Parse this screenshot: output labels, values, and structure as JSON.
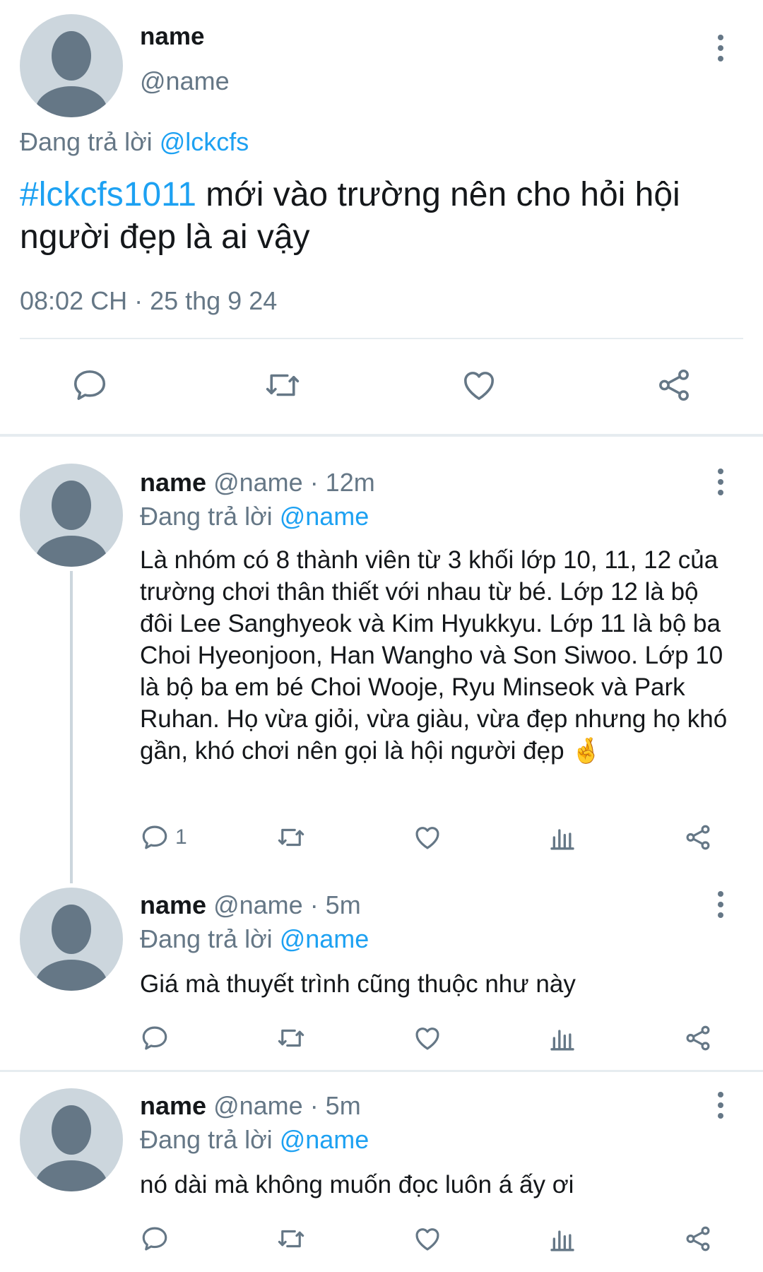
{
  "main_tweet": {
    "display_name": "name",
    "handle": "@name",
    "replying_to_label": "Đang trả lời",
    "replying_to_handle": "@lckcfs",
    "hashtag": "#lckcfs1011",
    "text": " mới vào trường nên cho hỏi hội người đẹp là ai vậy",
    "timestamp": "08:02 CH · 25 thg 9 24",
    "actions": [
      "reply-icon",
      "retweet-icon",
      "like-icon",
      "share-icon"
    ]
  },
  "replies": [
    {
      "display_name": "name",
      "handle": "@name",
      "time": "· 12m",
      "replying_to_label": "Đang trả lời",
      "replying_to_handle": "@name",
      "text": "Là nhóm có 8 thành viên từ 3 khối lớp 10, 11, 12 của trường chơi thân thiết với nhau từ bé. Lớp 12 là bộ đôi Lee Sanghyeok và Kim Hyukkyu. Lớp 11 là bộ ba Choi Hyeonjoon, Han Wangho và Son Siwoo. Lớp 10 là bộ ba em bé Choi Wooje, Ryu Minseok và Park Ruhan. Họ vừa giỏi, vừa giàu, vừa đẹp nhưng họ khó gần, khó chơi nên gọi là hội người đẹp",
      "emoji": "🤞",
      "reply_count": "1"
    },
    {
      "display_name": "name",
      "handle": "@name",
      "time": "· 5m",
      "replying_to_label": "Đang trả lời",
      "replying_to_handle": "@name",
      "text": "Giá mà thuyết trình cũng thuộc như này",
      "reply_count": ""
    },
    {
      "display_name": "name",
      "handle": "@name",
      "time": "· 5m",
      "replying_to_label": "Đang trả lời",
      "replying_to_handle": "@name",
      "text": "nó dài mà không muốn đọc luôn á ấy ơi",
      "reply_count": ""
    }
  ],
  "colors": {
    "accent": "#1da1f2",
    "secondary_text": "#657786",
    "avatar_bg": "#ccd6dd",
    "divider": "#e6ecf0"
  }
}
